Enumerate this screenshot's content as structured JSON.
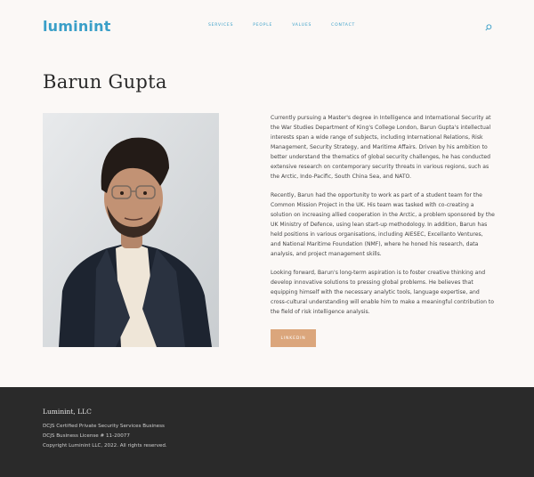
{
  "header": {
    "logo": "luminint",
    "nav": [
      "SERVICES",
      "PEOPLE",
      "VALUES",
      "CONTACT"
    ]
  },
  "page": {
    "title": "Barun Gupta"
  },
  "bio": {
    "paragraphs": [
      "Currently pursuing a Master's degree in Intelligence and International Security at the War Studies Department of King's College London, Barun Gupta's intellectual interests span a wide range of subjects, including International Relations, Risk Management, Security Strategy, and Maritime Affairs. Driven by his ambition to better understand the thematics of global security challenges, he has conducted extensive research on contemporary security threats in various regions, such as the Arctic, Indo-Pacific, South China Sea, and NATO.",
      "Recently, Barun had the opportunity to work as part of a student team for the Common Mission Project in the UK. His team was tasked with co-creating a solution on increasing allied cooperation in the Arctic, a problem sponsored by the UK Ministry of Defence, using lean start-up methodology. In addition, Barun has held positions in various organisations, including AIESEC, Excellanto Ventures, and National Maritime Foundation (NMF), where he honed his research, data analysis, and project management skills.",
      "Looking forward, Barun's long-term aspiration is to foster creative thinking and develop innovative solutions to pressing global problems. He believes that equipping himself with the necessary analytic tools, language expertise, and cross-cultural understanding will enable him to make a meaningful contribution to the field of risk intelligence analysis."
    ],
    "button": "LINKEDIN"
  },
  "footer": {
    "title": "Luminint, LLC",
    "lines": [
      "DCJS Certified Private Security Services Business",
      "DCJS Business License # 11-20077",
      "Copyright Luminint LLC, 2022.  All rights reserved."
    ]
  },
  "colors": {
    "background": "#fbf8f6",
    "accent": "#3a9fc8",
    "button": "#dba67c",
    "footer": "#2a2a2a"
  },
  "icons": {
    "search": "search-icon"
  }
}
